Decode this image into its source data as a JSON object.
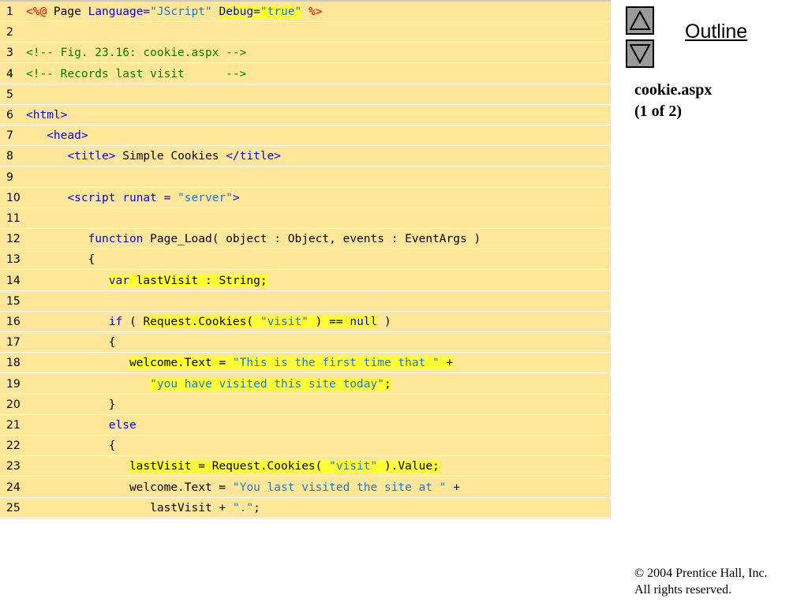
{
  "sidebar": {
    "outline_label": "Outline",
    "file_name": "cookie.aspx",
    "page_indicator": "(1 of 2)"
  },
  "footer": {
    "copyright": "© 2004 Prentice Hall, Inc.",
    "rights": "All rights reserved."
  },
  "code": {
    "lines": [
      {
        "num": "1",
        "tokens": [
          {
            "t": "<%@",
            "c": "dir"
          },
          {
            "t": " Page ",
            "c": "plain"
          },
          {
            "t": "Language=",
            "c": "tag"
          },
          {
            "t": "\"JScript\"",
            "c": "str"
          },
          {
            "t": " ",
            "c": "plain"
          },
          {
            "t": "Debug=",
            "c": "tag",
            "hl": true
          },
          {
            "t": "\"true\"",
            "c": "str",
            "hl": true
          },
          {
            "t": " ",
            "c": "plain"
          },
          {
            "t": "%>",
            "c": "dir"
          }
        ]
      },
      {
        "num": "2",
        "tokens": []
      },
      {
        "num": "3",
        "tokens": [
          {
            "t": "<!-- Fig. 23.16: cookie.aspx -->",
            "c": "com"
          }
        ]
      },
      {
        "num": "4",
        "tokens": [
          {
            "t": "<!-- Records last visit      -->",
            "c": "com"
          }
        ]
      },
      {
        "num": "5",
        "tokens": []
      },
      {
        "num": "6",
        "tokens": [
          {
            "t": "<html>",
            "c": "tag"
          }
        ]
      },
      {
        "num": "7",
        "tokens": [
          {
            "t": "   ",
            "c": "plain"
          },
          {
            "t": "<head>",
            "c": "tag"
          }
        ]
      },
      {
        "num": "8",
        "tokens": [
          {
            "t": "      ",
            "c": "plain"
          },
          {
            "t": "<title>",
            "c": "tag"
          },
          {
            "t": " Simple Cookies ",
            "c": "plain"
          },
          {
            "t": "</title>",
            "c": "tag"
          }
        ]
      },
      {
        "num": "9",
        "tokens": []
      },
      {
        "num": "10",
        "tokens": [
          {
            "t": "      ",
            "c": "plain"
          },
          {
            "t": "<script runat = ",
            "c": "tag"
          },
          {
            "t": "\"server\"",
            "c": "str"
          },
          {
            "t": ">",
            "c": "tag"
          }
        ]
      },
      {
        "num": "11",
        "tokens": []
      },
      {
        "num": "12",
        "tokens": [
          {
            "t": "         ",
            "c": "plain"
          },
          {
            "t": "function",
            "c": "kw"
          },
          {
            "t": " Page_Load( object : Object, events : EventArgs )",
            "c": "plain"
          }
        ]
      },
      {
        "num": "13",
        "tokens": [
          {
            "t": "         {",
            "c": "plain"
          }
        ]
      },
      {
        "num": "14",
        "tokens": [
          {
            "t": "            ",
            "c": "plain"
          },
          {
            "t": "var",
            "c": "kw",
            "hl": true
          },
          {
            "t": " lastVisit : String;",
            "c": "plain",
            "hl": true
          }
        ]
      },
      {
        "num": "15",
        "tokens": []
      },
      {
        "num": "16",
        "tokens": [
          {
            "t": "            ",
            "c": "plain"
          },
          {
            "t": "if",
            "c": "kw"
          },
          {
            "t": " ( ",
            "c": "plain"
          },
          {
            "t": "Request.Cookies( ",
            "c": "plain",
            "hl": true
          },
          {
            "t": "\"visit\"",
            "c": "str",
            "hl": true
          },
          {
            "t": " ) == ",
            "c": "plain",
            "hl": true
          },
          {
            "t": "null",
            "c": "kw",
            "hl": true
          },
          {
            "t": " )",
            "c": "plain"
          }
        ]
      },
      {
        "num": "17",
        "tokens": [
          {
            "t": "            {",
            "c": "plain"
          }
        ]
      },
      {
        "num": "18",
        "tokens": [
          {
            "t": "               ",
            "c": "plain"
          },
          {
            "t": "welcome.Text = ",
            "c": "plain",
            "hl": true
          },
          {
            "t": "\"This is the first time that \"",
            "c": "str",
            "hl": true
          },
          {
            "t": " +",
            "c": "plain",
            "hl": true
          }
        ]
      },
      {
        "num": "19",
        "tokens": [
          {
            "t": "                  ",
            "c": "plain"
          },
          {
            "t": "\"you have visited this site today\"",
            "c": "str",
            "hl": true
          },
          {
            "t": ";",
            "c": "plain",
            "hl": true
          }
        ]
      },
      {
        "num": "20",
        "tokens": [
          {
            "t": "            }",
            "c": "plain"
          }
        ]
      },
      {
        "num": "21",
        "tokens": [
          {
            "t": "            ",
            "c": "plain"
          },
          {
            "t": "else",
            "c": "kw"
          }
        ]
      },
      {
        "num": "22",
        "tokens": [
          {
            "t": "            {",
            "c": "plain"
          }
        ]
      },
      {
        "num": "23",
        "tokens": [
          {
            "t": "               ",
            "c": "plain"
          },
          {
            "t": "lastVisit = Request.Cookies( ",
            "c": "plain",
            "hl": true
          },
          {
            "t": "\"visit\"",
            "c": "str",
            "hl": true
          },
          {
            "t": " ).Value;",
            "c": "plain",
            "hl": true
          }
        ]
      },
      {
        "num": "24",
        "tokens": [
          {
            "t": "               welcome.Text = ",
            "c": "plain"
          },
          {
            "t": "\"You last visited the site at \"",
            "c": "str"
          },
          {
            "t": " +",
            "c": "plain"
          }
        ]
      },
      {
        "num": "25",
        "tokens": [
          {
            "t": "                  lastVisit + ",
            "c": "plain"
          },
          {
            "t": "\".\"",
            "c": "str"
          },
          {
            "t": ";",
            "c": "plain"
          }
        ]
      }
    ]
  },
  "colors": {
    "panel_bg": "#ffe699",
    "highlight": "#ffff33",
    "tag": "#0000ff",
    "string": "#1f78d1",
    "directive": "#ff0000",
    "comment": "#008000"
  },
  "icons": {
    "up": "triangle-up-icon",
    "down": "triangle-down-icon"
  }
}
